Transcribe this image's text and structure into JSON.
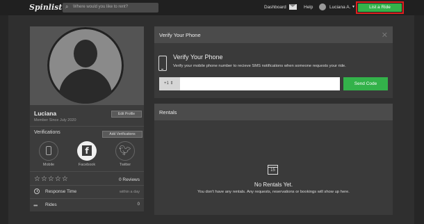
{
  "header": {
    "logo": "Spinlister",
    "search_placeholder": "Where would you like to rent?",
    "dashboard": "Dashboard",
    "help": "Help",
    "user_name": "Luciana A.",
    "list_ride": "List a Ride"
  },
  "profile": {
    "name": "Luciana",
    "member_since": "Member Since July 2020",
    "edit_profile": "Edit Profile",
    "verifications_title": "Verifications",
    "add_verifications": "Add Verifications",
    "verifications": [
      "Mobile",
      "Facebook",
      "Twitter"
    ],
    "stars": "☆☆☆☆☆",
    "reviews": "0 Reviews",
    "response_time_label": "Response Time",
    "response_time_value": "within a day",
    "rides_label": "Rides",
    "rides_value": "0"
  },
  "verify_phone": {
    "panel_title": "Verify Your Phone",
    "heading": "Verify Your Phone",
    "description": "Verify your mobile phone number to recieve SMS notifications when someone requests your ride.",
    "country_code": "+1",
    "send_code": "Send Code"
  },
  "rentals": {
    "panel_title": "Rentals",
    "calendar_day": "15",
    "empty_title": "No Rentals Yet.",
    "empty_desc": "You don't have any rentals. Any requests, reservations or bookings will show up here."
  },
  "colors": {
    "accent_green": "#33b24a",
    "highlight_red": "#e01e1e"
  }
}
